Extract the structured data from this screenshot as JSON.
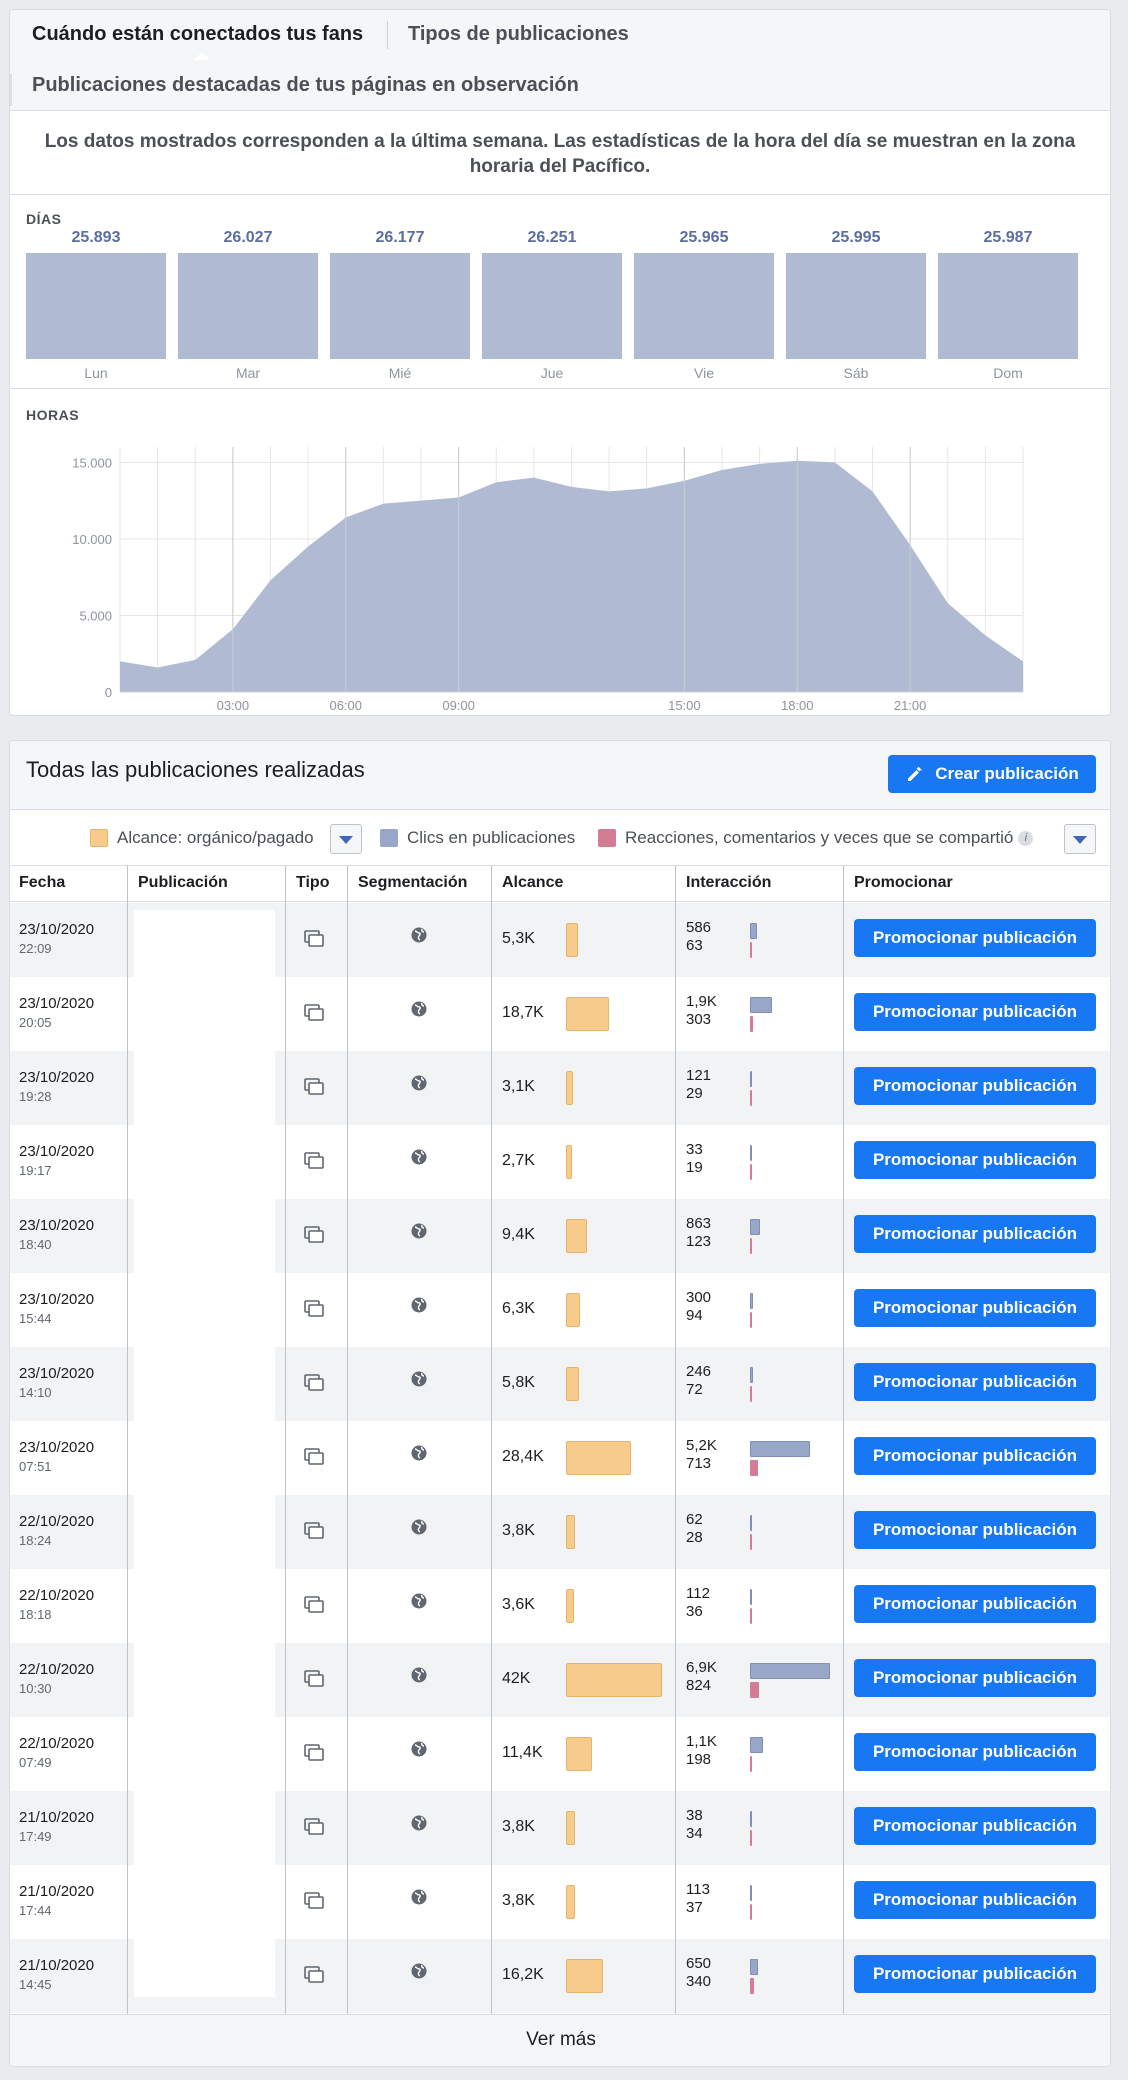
{
  "tabs": {
    "fans": "Cuándo están conectados tus fans",
    "types": "Tipos de publicaciones",
    "featured": "Publicaciones destacadas de tus páginas en observación"
  },
  "notice": "Los datos mostrados corresponden a la última semana. Las estadísticas de la hora del día se muestran en la zona horaria del Pacífico.",
  "days": {
    "label": "DÍAS",
    "items": [
      {
        "day": "Lun",
        "value": "25.893"
      },
      {
        "day": "Mar",
        "value": "26.027"
      },
      {
        "day": "Mié",
        "value": "26.177"
      },
      {
        "day": "Jue",
        "value": "26.251"
      },
      {
        "day": "Vie",
        "value": "25.965"
      },
      {
        "day": "Sáb",
        "value": "25.995"
      },
      {
        "day": "Dom",
        "value": "25.987"
      }
    ]
  },
  "chart_data": {
    "type": "area",
    "title": "HORAS",
    "x": [
      0,
      1,
      2,
      3,
      4,
      5,
      6,
      7,
      8,
      9,
      10,
      11,
      12,
      13,
      14,
      15,
      16,
      17,
      18,
      19,
      20,
      21,
      22,
      23,
      24
    ],
    "x_tick_labels": {
      "3": "03:00",
      "6": "06:00",
      "9": "09:00",
      "15": "15:00",
      "18": "18:00",
      "21": "21:00"
    },
    "values": [
      2000,
      1600,
      2100,
      4100,
      7300,
      9500,
      11400,
      12300,
      12500,
      12700,
      13700,
      14000,
      13400,
      13100,
      13300,
      13800,
      14500,
      14900,
      15100,
      15000,
      13100,
      9600,
      5800,
      3700,
      2000
    ],
    "yticks": [
      {
        "value": 0,
        "label": "0"
      },
      {
        "value": 5000,
        "label": "5.000"
      },
      {
        "value": 10000,
        "label": "10.000"
      },
      {
        "value": 15000,
        "label": "15.000"
      }
    ],
    "ylim": [
      0,
      16000
    ],
    "xlim": [
      0,
      24
    ],
    "grid": true,
    "color": "#b0bbd3"
  },
  "posts": {
    "title": "Todas las publicaciones realizadas",
    "create_label": "Crear publicación",
    "legend": {
      "reach": "Alcance: orgánico/pagado",
      "clicks": "Clics en publicaciones",
      "reactions": "Reacciones, comentarios y veces que se compartió"
    },
    "colors": {
      "reach": "#f7cb8c",
      "clicks": "#98a6c7",
      "reactions": "#d47c93",
      "button": "#1877f2"
    },
    "columns": {
      "date": "Fecha",
      "post": "Publicación",
      "type": "Tipo",
      "targeting": "Segmentación",
      "reach": "Alcance",
      "engagement": "Interacción",
      "promote": "Promocionar"
    },
    "promote_label": "Promocionar publicación",
    "more_label": "Ver más",
    "rows": [
      {
        "date": "23/10/2020",
        "time": "22:09",
        "reach": "5,3K",
        "reach_value": 5300,
        "clicks": "586",
        "clicks_value": 586,
        "reactions": "63",
        "reactions_value": 63
      },
      {
        "date": "23/10/2020",
        "time": "20:05",
        "reach": "18,7K",
        "reach_value": 18700,
        "clicks": "1,9K",
        "clicks_value": 1900,
        "reactions": "303",
        "reactions_value": 303
      },
      {
        "date": "23/10/2020",
        "time": "19:28",
        "reach": "3,1K",
        "reach_value": 3100,
        "clicks": "121",
        "clicks_value": 121,
        "reactions": "29",
        "reactions_value": 29
      },
      {
        "date": "23/10/2020",
        "time": "19:17",
        "reach": "2,7K",
        "reach_value": 2700,
        "clicks": "33",
        "clicks_value": 33,
        "reactions": "19",
        "reactions_value": 19
      },
      {
        "date": "23/10/2020",
        "time": "18:40",
        "reach": "9,4K",
        "reach_value": 9400,
        "clicks": "863",
        "clicks_value": 863,
        "reactions": "123",
        "reactions_value": 123
      },
      {
        "date": "23/10/2020",
        "time": "15:44",
        "reach": "6,3K",
        "reach_value": 6300,
        "clicks": "300",
        "clicks_value": 300,
        "reactions": "94",
        "reactions_value": 94
      },
      {
        "date": "23/10/2020",
        "time": "14:10",
        "reach": "5,8K",
        "reach_value": 5800,
        "clicks": "246",
        "clicks_value": 246,
        "reactions": "72",
        "reactions_value": 72
      },
      {
        "date": "23/10/2020",
        "time": "07:51",
        "reach": "28,4K",
        "reach_value": 28400,
        "clicks": "5,2K",
        "clicks_value": 5200,
        "reactions": "713",
        "reactions_value": 713
      },
      {
        "date": "22/10/2020",
        "time": "18:24",
        "reach": "3,8K",
        "reach_value": 3800,
        "clicks": "62",
        "clicks_value": 62,
        "reactions": "28",
        "reactions_value": 28
      },
      {
        "date": "22/10/2020",
        "time": "18:18",
        "reach": "3,6K",
        "reach_value": 3600,
        "clicks": "112",
        "clicks_value": 112,
        "reactions": "36",
        "reactions_value": 36
      },
      {
        "date": "22/10/2020",
        "time": "10:30",
        "reach": "42K",
        "reach_value": 42000,
        "clicks": "6,9K",
        "clicks_value": 6900,
        "reactions": "824",
        "reactions_value": 824
      },
      {
        "date": "22/10/2020",
        "time": "07:49",
        "reach": "11,4K",
        "reach_value": 11400,
        "clicks": "1,1K",
        "clicks_value": 1100,
        "reactions": "198",
        "reactions_value": 198
      },
      {
        "date": "21/10/2020",
        "time": "17:49",
        "reach": "3,8K",
        "reach_value": 3800,
        "clicks": "38",
        "clicks_value": 38,
        "reactions": "34",
        "reactions_value": 34
      },
      {
        "date": "21/10/2020",
        "time": "17:44",
        "reach": "3,8K",
        "reach_value": 3800,
        "clicks": "113",
        "clicks_value": 113,
        "reactions": "37",
        "reactions_value": 37
      },
      {
        "date": "21/10/2020",
        "time": "14:45",
        "reach": "16,2K",
        "reach_value": 16200,
        "clicks": "650",
        "clicks_value": 650,
        "reactions": "340",
        "reactions_value": 340
      }
    ]
  }
}
